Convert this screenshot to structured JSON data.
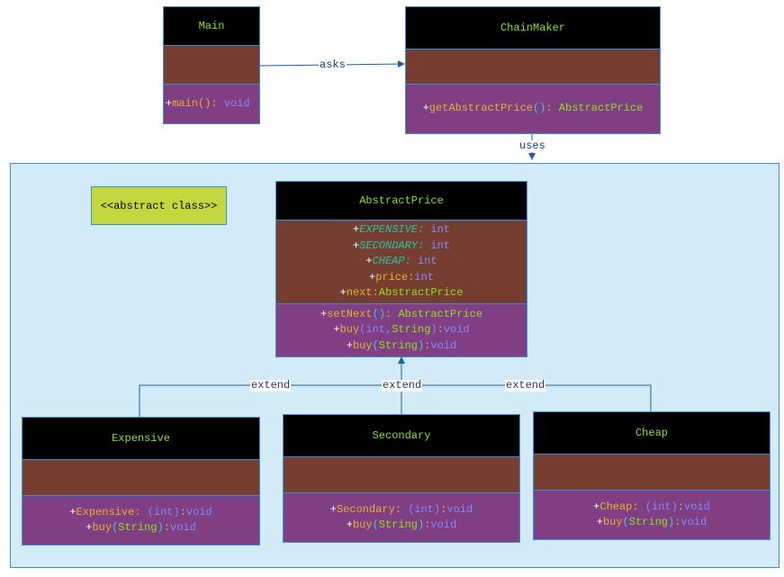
{
  "stereotype": "<<abstract class>>",
  "relations": {
    "asks": "asks",
    "uses": "uses",
    "extend1": "extend",
    "extend2": "extend",
    "extend3": "extend"
  },
  "colors": {
    "header": "#000000",
    "attributes": "#763d31",
    "operations": "#7f3f82",
    "package": "#d2ebf6",
    "stereotype": "#c2d83e",
    "border": "#3a8fd8"
  },
  "classes": {
    "main": {
      "name": "Main",
      "attrs": [],
      "ops": [
        [
          [
            "+",
            "plus"
          ],
          [
            "main",
            "name"
          ],
          [
            "()",
            "name"
          ],
          [
            ": ",
            "name"
          ],
          [
            "void",
            "type"
          ]
        ]
      ]
    },
    "chainmaker": {
      "name": "ChainMaker",
      "attrs": [],
      "ops": [
        [
          [
            "+",
            "plus"
          ],
          [
            "getAbstractPrice",
            "name"
          ],
          [
            "()",
            "paren"
          ],
          [
            ": ",
            "name"
          ],
          [
            "AbstractPrice",
            "cls"
          ]
        ]
      ]
    },
    "abstractprice": {
      "name": "AbstractPrice",
      "attrs": [
        [
          [
            "+",
            "plus"
          ],
          [
            "EXPENSIVE:",
            "static"
          ],
          [
            " int",
            "type"
          ]
        ],
        [
          [
            "+",
            "plus"
          ],
          [
            "SECONDARY:",
            "static"
          ],
          [
            " int",
            "type"
          ]
        ],
        [
          [
            "+",
            "plus"
          ],
          [
            "CHEAP:",
            "static"
          ],
          [
            " int",
            "type"
          ]
        ],
        [
          [
            "+",
            "plus"
          ],
          [
            "price:",
            "name"
          ],
          [
            "int",
            "type"
          ]
        ],
        [
          [
            "+",
            "plus"
          ],
          [
            "next:",
            "name"
          ],
          [
            "AbstractPrice",
            "cls"
          ]
        ]
      ],
      "ops": [
        [
          [
            "+",
            "plus"
          ],
          [
            "setNext",
            "name"
          ],
          [
            "()",
            "paren"
          ],
          [
            ": ",
            "name"
          ],
          [
            "AbstractPrice",
            "cls"
          ]
        ],
        [
          [
            "+",
            "plus"
          ],
          [
            "buy",
            "name"
          ],
          [
            "(int,",
            "type"
          ],
          [
            "String",
            "cls"
          ],
          [
            ")",
            "type"
          ],
          [
            ":",
            "name"
          ],
          [
            "void",
            "type"
          ]
        ],
        [
          [
            "+",
            "plus"
          ],
          [
            "buy",
            "name"
          ],
          [
            "(",
            "paren"
          ],
          [
            "String",
            "cls"
          ],
          [
            ")",
            "paren"
          ],
          [
            ":",
            "name"
          ],
          [
            "void",
            "type"
          ]
        ]
      ]
    },
    "expensive": {
      "name": "Expensive",
      "attrs": [],
      "ops": [
        [
          [
            "+",
            "plus"
          ],
          [
            "Expensive: ",
            "name"
          ],
          [
            "(int)",
            "type"
          ],
          [
            ":",
            "name"
          ],
          [
            "void",
            "type"
          ]
        ],
        [
          [
            "+",
            "plus"
          ],
          [
            "buy",
            "name"
          ],
          [
            "(",
            "paren"
          ],
          [
            "String",
            "cls"
          ],
          [
            ")",
            "paren"
          ],
          [
            ":",
            "name"
          ],
          [
            "void",
            "type"
          ]
        ]
      ]
    },
    "secondary": {
      "name": "Secondary",
      "attrs": [],
      "ops": [
        [
          [
            "+",
            "plus"
          ],
          [
            "Secondary: ",
            "name"
          ],
          [
            "(int)",
            "type"
          ],
          [
            ":",
            "name"
          ],
          [
            "void",
            "type"
          ]
        ],
        [
          [
            "+",
            "plus"
          ],
          [
            "buy",
            "name"
          ],
          [
            "(",
            "paren"
          ],
          [
            "String",
            "cls"
          ],
          [
            ")",
            "paren"
          ],
          [
            ":",
            "name"
          ],
          [
            "void",
            "type"
          ]
        ]
      ]
    },
    "cheap": {
      "name": "Cheap",
      "attrs": [],
      "ops": [
        [
          [
            "+",
            "plus"
          ],
          [
            "Cheap: ",
            "name"
          ],
          [
            "(int)",
            "type"
          ],
          [
            ":",
            "name"
          ],
          [
            "void",
            "type"
          ]
        ],
        [
          [
            "+",
            "plus"
          ],
          [
            "buy",
            "name"
          ],
          [
            "(",
            "paren"
          ],
          [
            "String",
            "cls"
          ],
          [
            ")",
            "paren"
          ],
          [
            ":",
            "name"
          ],
          [
            "void",
            "type"
          ]
        ]
      ]
    }
  }
}
